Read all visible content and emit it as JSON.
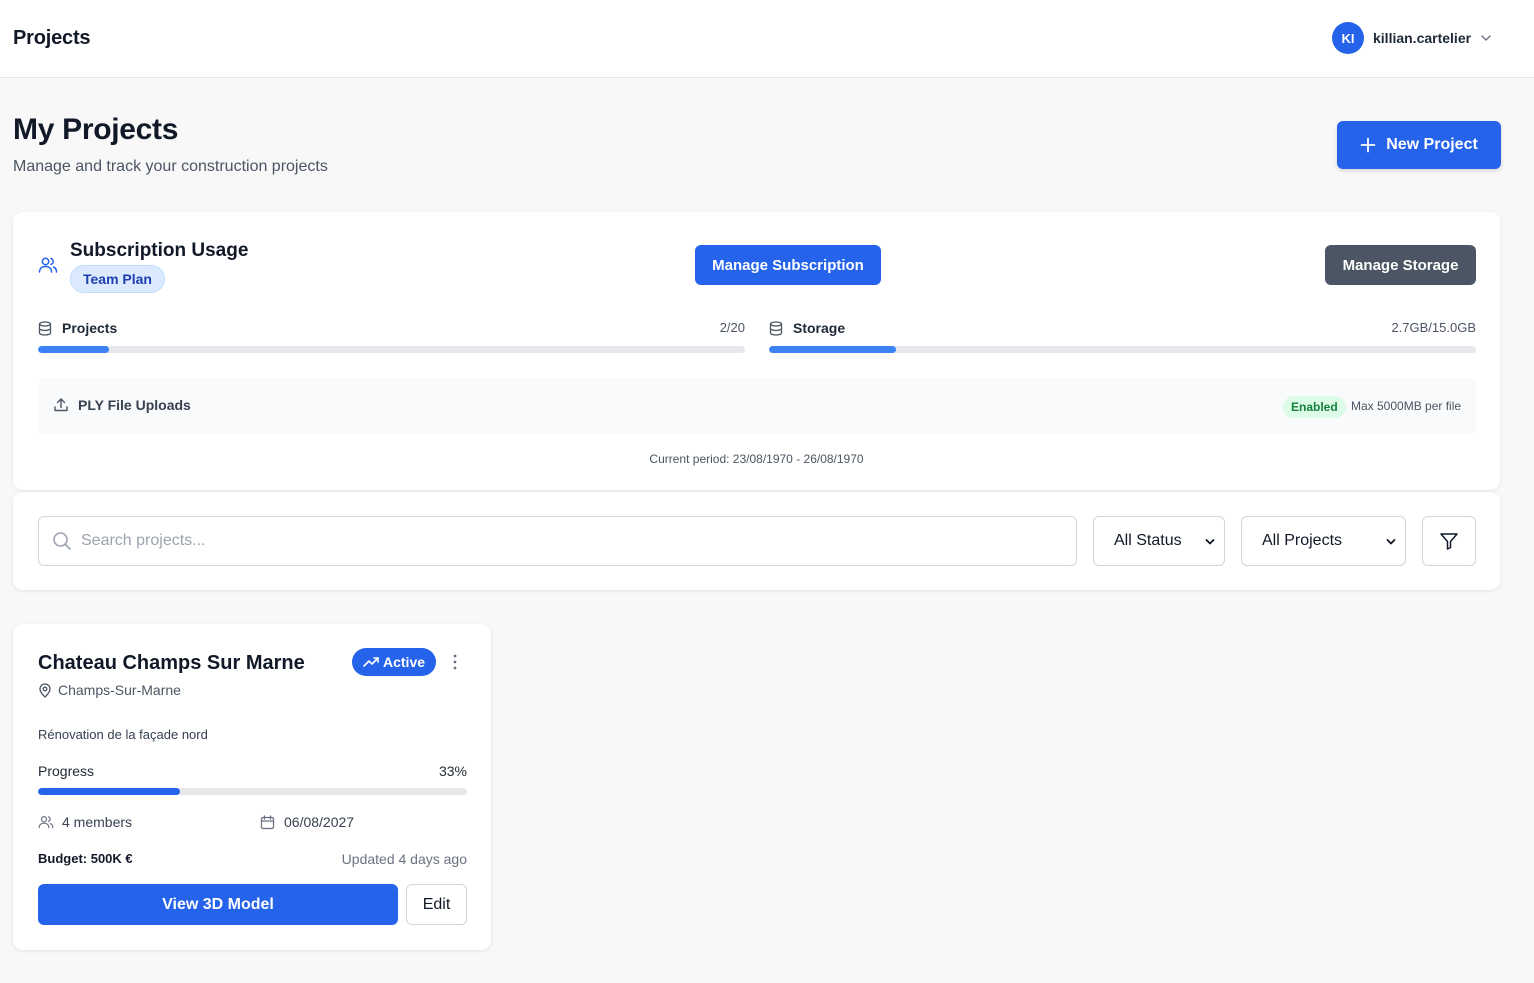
{
  "topbar": {
    "title": "Projects",
    "user": {
      "initials": "KI",
      "username": "killian.cartelier"
    }
  },
  "header": {
    "title": "My Projects",
    "subtitle": "Manage and track your construction projects",
    "new_project_label": "New Project"
  },
  "subscription": {
    "title": "Subscription Usage",
    "plan": "Team Plan",
    "manage_subscription_label": "Manage Subscription",
    "manage_storage_label": "Manage Storage",
    "projects": {
      "label": "Projects",
      "value": "2/20",
      "used": 2,
      "limit": 20
    },
    "storage": {
      "label": "Storage",
      "value": "2.7GB/15.0GB",
      "used": 2.7,
      "limit": 15.0
    },
    "ply": {
      "label": "PLY File Uploads",
      "status": "Enabled",
      "max": "Max 5000MB per file"
    },
    "period": "Current period: 23/08/1970 - 26/08/1970"
  },
  "filters": {
    "search_placeholder": "Search projects...",
    "status_selected": "All Status",
    "projects_selected": "All Projects"
  },
  "projects": [
    {
      "name": "Chateau Champs Sur Marne",
      "status": "Active",
      "location": "Champs-Sur-Marne",
      "description": "Rénovation de la façade nord",
      "progress_label": "Progress",
      "progress_text": "33%",
      "progress": 33,
      "members": "4 members",
      "due_date": "06/08/2027",
      "budget": "Budget: 500K €",
      "updated": "Updated 4 days ago",
      "view_label": "View 3D Model",
      "edit_label": "Edit"
    }
  ],
  "colors": {
    "primary": "#2563eb",
    "meter_fill": "#3b82f6",
    "dark_button": "#4b5563",
    "enabled_bg": "#dcfce7",
    "enabled_text": "#15803d"
  }
}
